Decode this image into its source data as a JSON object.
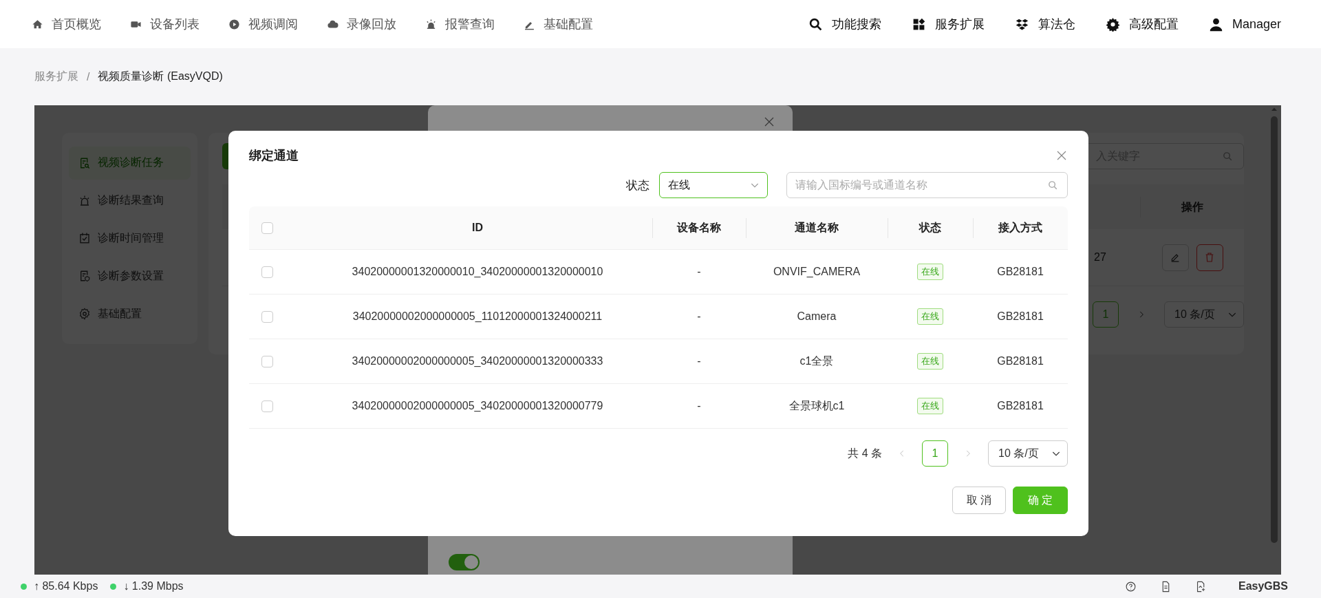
{
  "nav": {
    "left": [
      {
        "label": "首页概览"
      },
      {
        "label": "设备列表"
      },
      {
        "label": "视频调阅"
      },
      {
        "label": "录像回放"
      },
      {
        "label": "报警查询"
      },
      {
        "label": "基础配置"
      }
    ],
    "right": [
      {
        "label": "功能搜索"
      },
      {
        "label": "服务扩展"
      },
      {
        "label": "算法仓"
      },
      {
        "label": "高级配置"
      },
      {
        "label": "Manager"
      }
    ]
  },
  "breadcrumb": [
    "服务扩展",
    "/",
    "视频质量诊断 (EasyVQD)"
  ],
  "sidebar": {
    "items": [
      {
        "label": "视频诊断任务",
        "selected": true
      },
      {
        "label": "诊断结果查询",
        "selected": false
      },
      {
        "label": "诊断时间管理",
        "selected": false
      },
      {
        "label": "诊断参数设置",
        "selected": false
      },
      {
        "label": "基础配置",
        "selected": false
      }
    ]
  },
  "task_panel": {
    "search": {
      "placeholder": "入关键字"
    },
    "column": "操作",
    "row_cell": "27",
    "page": "1",
    "page_size": "10 条/页"
  },
  "task_dialog": {
    "enabled_toggle": {
      "on": true
    }
  },
  "bind_dialog": {
    "title": "绑定通道",
    "filter_label": "状态",
    "status_select": "在线",
    "search": {
      "placeholder": "请输入国标编号或通道名称"
    },
    "select_all": {
      "checked": false
    },
    "columns": [
      "ID",
      "设备名称",
      "通道名称",
      "状态",
      "接入方式"
    ],
    "rows": [
      {
        "checked": false,
        "id": "34020000001320000010_34020000001320000010",
        "device": "-",
        "channel": "ONVIF_CAMERA",
        "status": "在线",
        "access": "GB28181"
      },
      {
        "checked": false,
        "id": "34020000002000000005_11012000001324000211",
        "device": "-",
        "channel": "Camera",
        "status": "在线",
        "access": "GB28181"
      },
      {
        "checked": false,
        "id": "34020000002000000005_34020000001320000333",
        "device": "-",
        "channel": "c1全景",
        "status": "在线",
        "access": "GB28181"
      },
      {
        "checked": false,
        "id": "34020000002000000005_34020000001320000779",
        "device": "-",
        "channel": "全景球机c1",
        "status": "在线",
        "access": "GB28181"
      }
    ],
    "total": "共 4 条",
    "pages": [
      {
        "label": "1",
        "selected": true
      }
    ],
    "page_size": "10 条/页",
    "buttons": [
      "取 消",
      "确 定"
    ]
  },
  "status_bar": {
    "upload": "↑ 85.64 Kbps",
    "download": "↓ 1.39 Mbps",
    "brand": "EasyGBS"
  }
}
